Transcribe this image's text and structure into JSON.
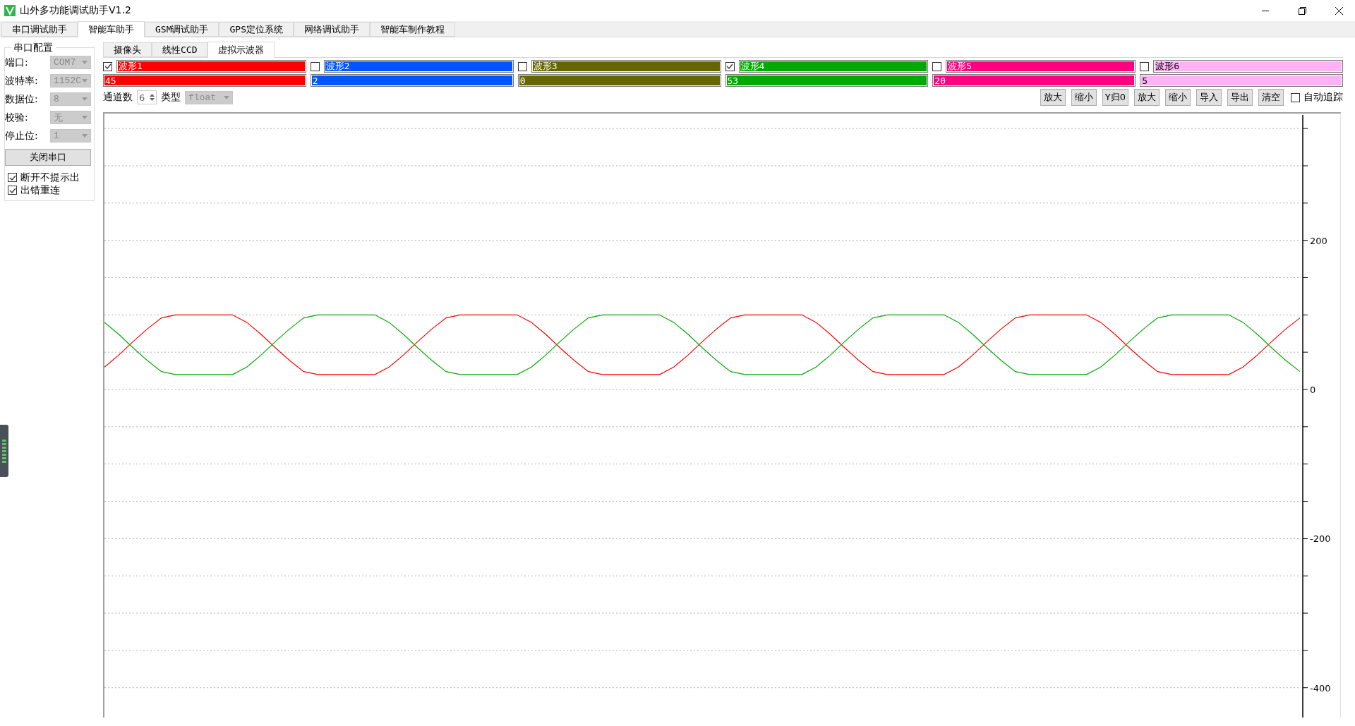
{
  "window": {
    "title": "山外多功能调试助手V1.2"
  },
  "main_tabs": [
    {
      "label": "串口调试助手",
      "selected": false
    },
    {
      "label": "智能车助手",
      "selected": true
    },
    {
      "label": "GSM调试助手",
      "selected": false
    },
    {
      "label": "GPS定位系统",
      "selected": false
    },
    {
      "label": "网络调试助手",
      "selected": false
    },
    {
      "label": "智能车制作教程",
      "selected": false
    }
  ],
  "serial_config": {
    "title": "串口配置",
    "fields": [
      {
        "label": "端口:",
        "value": "COM7",
        "disabled": true
      },
      {
        "label": "波特率:",
        "value": "1152C",
        "disabled": true
      },
      {
        "label": "数据位:",
        "value": "8",
        "disabled": true
      },
      {
        "label": "校验:",
        "value": "无",
        "disabled": true
      },
      {
        "label": "停止位:",
        "value": "1",
        "disabled": true
      }
    ],
    "button": "关闭串口",
    "options": [
      {
        "label": "断开不提示出",
        "checked": true
      },
      {
        "label": "出错重连",
        "checked": true
      }
    ]
  },
  "sub_tabs": [
    {
      "label": "摄像头",
      "selected": false
    },
    {
      "label": "线性CCD",
      "selected": false
    },
    {
      "label": "虚拟示波器",
      "selected": true
    }
  ],
  "channels": [
    {
      "name": "波形1",
      "checked": true,
      "value": "45",
      "color": "#ff0000"
    },
    {
      "name": "波形2",
      "checked": false,
      "value": "2",
      "color": "#0055ff"
    },
    {
      "name": "波形3",
      "checked": false,
      "value": "0",
      "color": "#666600"
    },
    {
      "name": "波形4",
      "checked": true,
      "value": "53",
      "color": "#00aa00"
    },
    {
      "name": "波形5",
      "checked": false,
      "value": "20",
      "color": "#ff0080"
    },
    {
      "name": "波形6",
      "checked": false,
      "value": "5",
      "color": "#ffb3f5"
    }
  ],
  "channel_count": {
    "label": "通道数",
    "value": "6"
  },
  "type_select": {
    "label": "类型",
    "value": "float",
    "disabled": true
  },
  "tool_buttons": [
    "放大",
    "缩小",
    "Y归0",
    "放大",
    "缩小",
    "导入",
    "导出",
    "清空"
  ],
  "auto_track": {
    "label": "自动追踪",
    "checked": false
  },
  "scope": {
    "chart_data": {
      "type": "line",
      "grid": true,
      "ylim": [
        -440,
        370
      ],
      "yticks": [
        -400,
        -200,
        0,
        200
      ],
      "series": [
        {
          "color": "#ff0000",
          "values": [
            30,
            46,
            64,
            81,
            96,
            100,
            100,
            100,
            100,
            100,
            90,
            74,
            56,
            39,
            24,
            20,
            20,
            20,
            20,
            20,
            30,
            46,
            64,
            81,
            96,
            100,
            100,
            100,
            100,
            100,
            90,
            74,
            56,
            39,
            24,
            20,
            20,
            20,
            20,
            20,
            30,
            46,
            64,
            81,
            96,
            100,
            100,
            100,
            100,
            100,
            90,
            74,
            56,
            39,
            24,
            20,
            20,
            20,
            20,
            20,
            30,
            46,
            64,
            81,
            96,
            100,
            100,
            100,
            100,
            100,
            90,
            74,
            56,
            39,
            24,
            20,
            20,
            20,
            20,
            20,
            30,
            46,
            64,
            81,
            96
          ]
        },
        {
          "color": "#00aa00",
          "values": [
            90,
            74,
            56,
            39,
            24,
            20,
            20,
            20,
            20,
            20,
            30,
            46,
            64,
            81,
            96,
            100,
            100,
            100,
            100,
            100,
            90,
            74,
            56,
            39,
            24,
            20,
            20,
            20,
            20,
            20,
            30,
            46,
            64,
            81,
            96,
            100,
            100,
            100,
            100,
            100,
            90,
            74,
            56,
            39,
            24,
            20,
            20,
            20,
            20,
            20,
            30,
            46,
            64,
            81,
            96,
            100,
            100,
            100,
            100,
            100,
            90,
            74,
            56,
            39,
            24,
            20,
            20,
            20,
            20,
            20,
            30,
            46,
            64,
            81,
            96,
            100,
            100,
            100,
            100,
            100,
            90,
            74,
            56,
            39,
            24
          ]
        }
      ]
    }
  }
}
